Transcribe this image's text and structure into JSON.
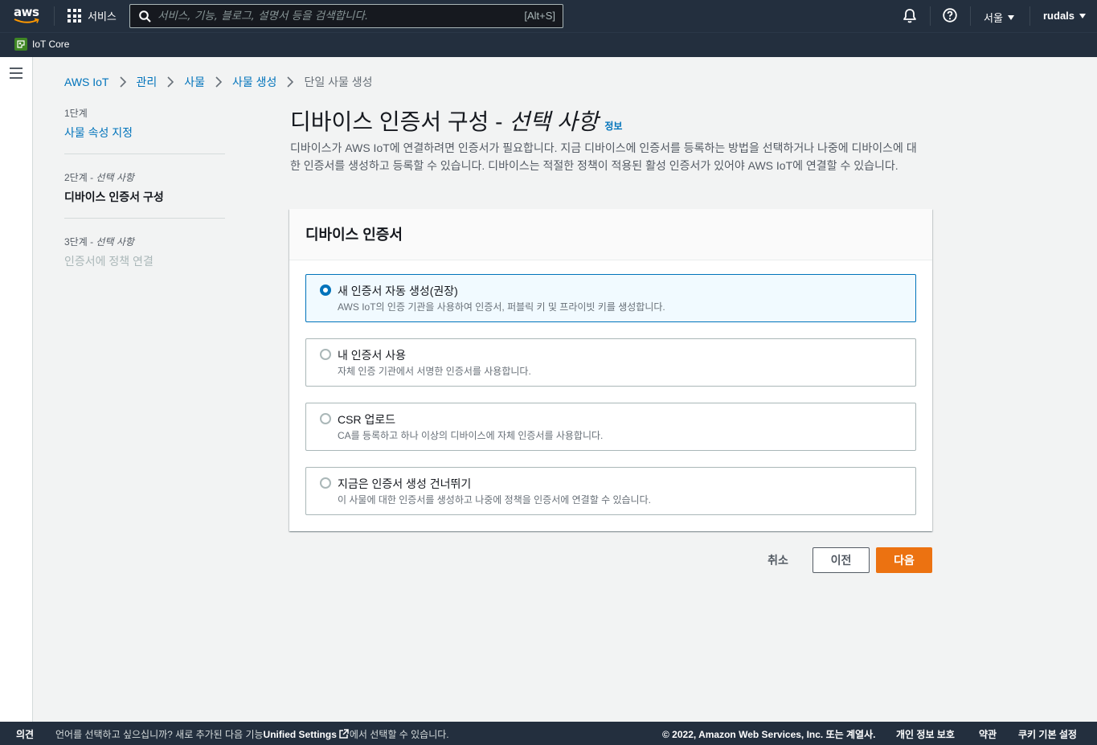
{
  "topnav": {
    "logo_text": "aws",
    "services_label": "서비스",
    "search_placeholder": "서비스, 기능, 블로그, 설명서 등을 검색합니다.",
    "search_shortcut": "[Alt+S]",
    "region_label": "서울",
    "user_label": "rudals"
  },
  "servicebar": {
    "favorite_label": "IoT Core"
  },
  "breadcrumb": {
    "items": [
      "AWS IoT",
      "관리",
      "사물",
      "사물 생성"
    ],
    "current": "단일 사물 생성"
  },
  "steps": [
    {
      "num": "1단계",
      "optional": "",
      "label": "사물 속성 지정",
      "state": "link"
    },
    {
      "num": "2단계 - ",
      "optional": "선택 사항",
      "label": "디바이스 인증서 구성",
      "state": "current"
    },
    {
      "num": "3단계 - ",
      "optional": "선택 사항",
      "label": "인증서에 정책 연결",
      "state": "disabled"
    }
  ],
  "header": {
    "title": "디바이스 인증서 구성 -",
    "title_optional": "선택 사항",
    "info_link": "정보",
    "description": "디바이스가 AWS IoT에 연결하려면 인증서가 필요합니다. 지금 디바이스에 인증서를 등록하는 방법을 선택하거나 나중에 디바이스에 대한 인증서를 생성하고 등록할 수 있습니다. 디바이스는 적절한 정책이 적용된 활성 인증서가 있어야 AWS IoT에 연결할 수 있습니다."
  },
  "container": {
    "title": "디바이스 인증서",
    "options": [
      {
        "label": "새 인증서 자동 생성(권장)",
        "description": "AWS IoT의 인증 기관을 사용하여 인증서, 퍼블릭 키 및 프라이빗 키를 생성합니다.",
        "selected": true
      },
      {
        "label": "내 인증서 사용",
        "description": "자체 인증 기관에서 서명한 인증서를 사용합니다.",
        "selected": false
      },
      {
        "label": "CSR 업로드",
        "description": "CA를 등록하고 하나 이상의 디바이스에 자체 인증서를 사용합니다.",
        "selected": false
      },
      {
        "label": "지금은 인증서 생성 건너뛰기",
        "description": "이 사물에 대한 인증서를 생성하고 나중에 정책을 인증서에 연결할 수 있습니다.",
        "selected": false
      }
    ]
  },
  "actions": {
    "cancel": "취소",
    "previous": "이전",
    "next": "다음"
  },
  "footer": {
    "feedback": "의견",
    "language_prompt": "언어를 선택하고 싶으십니까? 새로 추가된 다음 기능",
    "unified_settings": "Unified Settings",
    "language_suffix": "에서 선택할 수 있습니다.",
    "copyright": "© 2022, Amazon Web Services, Inc. 또는 계열사.",
    "privacy": "개인 정보 보호",
    "terms": "약관",
    "cookies": "쿠키 기본 설정"
  },
  "colors": {
    "nav_bg": "#232f3e",
    "link": "#0073bb",
    "primary_button": "#ec7211",
    "selected_tile_bg": "#f1faff"
  }
}
